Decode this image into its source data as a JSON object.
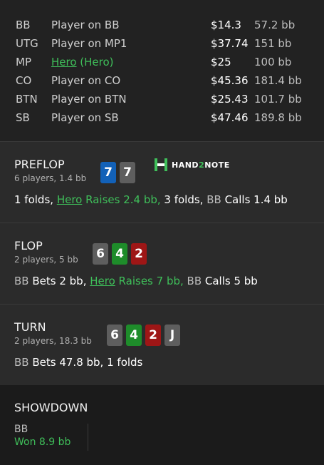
{
  "players": [
    {
      "pos": "BB",
      "name": "Player on BB",
      "stack": "$14.3",
      "bb": "57.2 bb"
    },
    {
      "pos": "UTG",
      "name": "Player on MP1",
      "stack": "$37.74",
      "bb": "151 bb"
    },
    {
      "pos": "MP",
      "name": "Hero",
      "name_suffix": " (Hero)",
      "stack": "$25",
      "bb": "100 bb"
    },
    {
      "pos": "CO",
      "name": "Player on CO",
      "stack": "$45.36",
      "bb": "181.4 bb"
    },
    {
      "pos": "BTN",
      "name": "Player on BTN",
      "stack": "$25.43",
      "bb": "101.7 bb"
    },
    {
      "pos": "SB",
      "name": "Player on SB",
      "stack": "$47.46",
      "bb": "189.8 bb"
    }
  ],
  "brand": {
    "part1": "HAND",
    "part2": "2",
    "part3": "NOTE"
  },
  "colors": {
    "accent_green": "#3fbf5a",
    "card_blue": "#1261b8",
    "card_gray": "#5e5e5e",
    "card_green": "#1e8c2a",
    "card_red": "#9e1616"
  },
  "preflop": {
    "title": "PREFLOP",
    "sub": "6 players, 1.4 bb",
    "cards": [
      "7",
      "7"
    ],
    "actions": {
      "a1": "1 folds, ",
      "hero": "Hero",
      "hero_action": " Raises 2.4 bb,",
      "a2": " 3 folds, ",
      "pos": "BB",
      "a3": " Calls 1.4 bb"
    }
  },
  "flop": {
    "title": "FLOP",
    "sub": "2 players, 5 bb",
    "cards": [
      "6",
      "4",
      "2"
    ],
    "actions": {
      "pos": "BB",
      "a1": " Bets 2 bb, ",
      "hero": "Hero",
      "hero_action": " Raises 7 bb,",
      "pos2": " BB",
      "a2": " Calls 5 bb"
    }
  },
  "turn": {
    "title": "TURN",
    "sub": "2 players, 18.3 bb",
    "cards": [
      "6",
      "4",
      "2",
      "J"
    ],
    "actions": {
      "pos": "BB",
      "a1": " Bets 47.8 bb,",
      "a2": " 1 folds"
    }
  },
  "showdown": {
    "title": "SHOWDOWN",
    "player": "BB",
    "result": "Won 8.9 bb"
  }
}
